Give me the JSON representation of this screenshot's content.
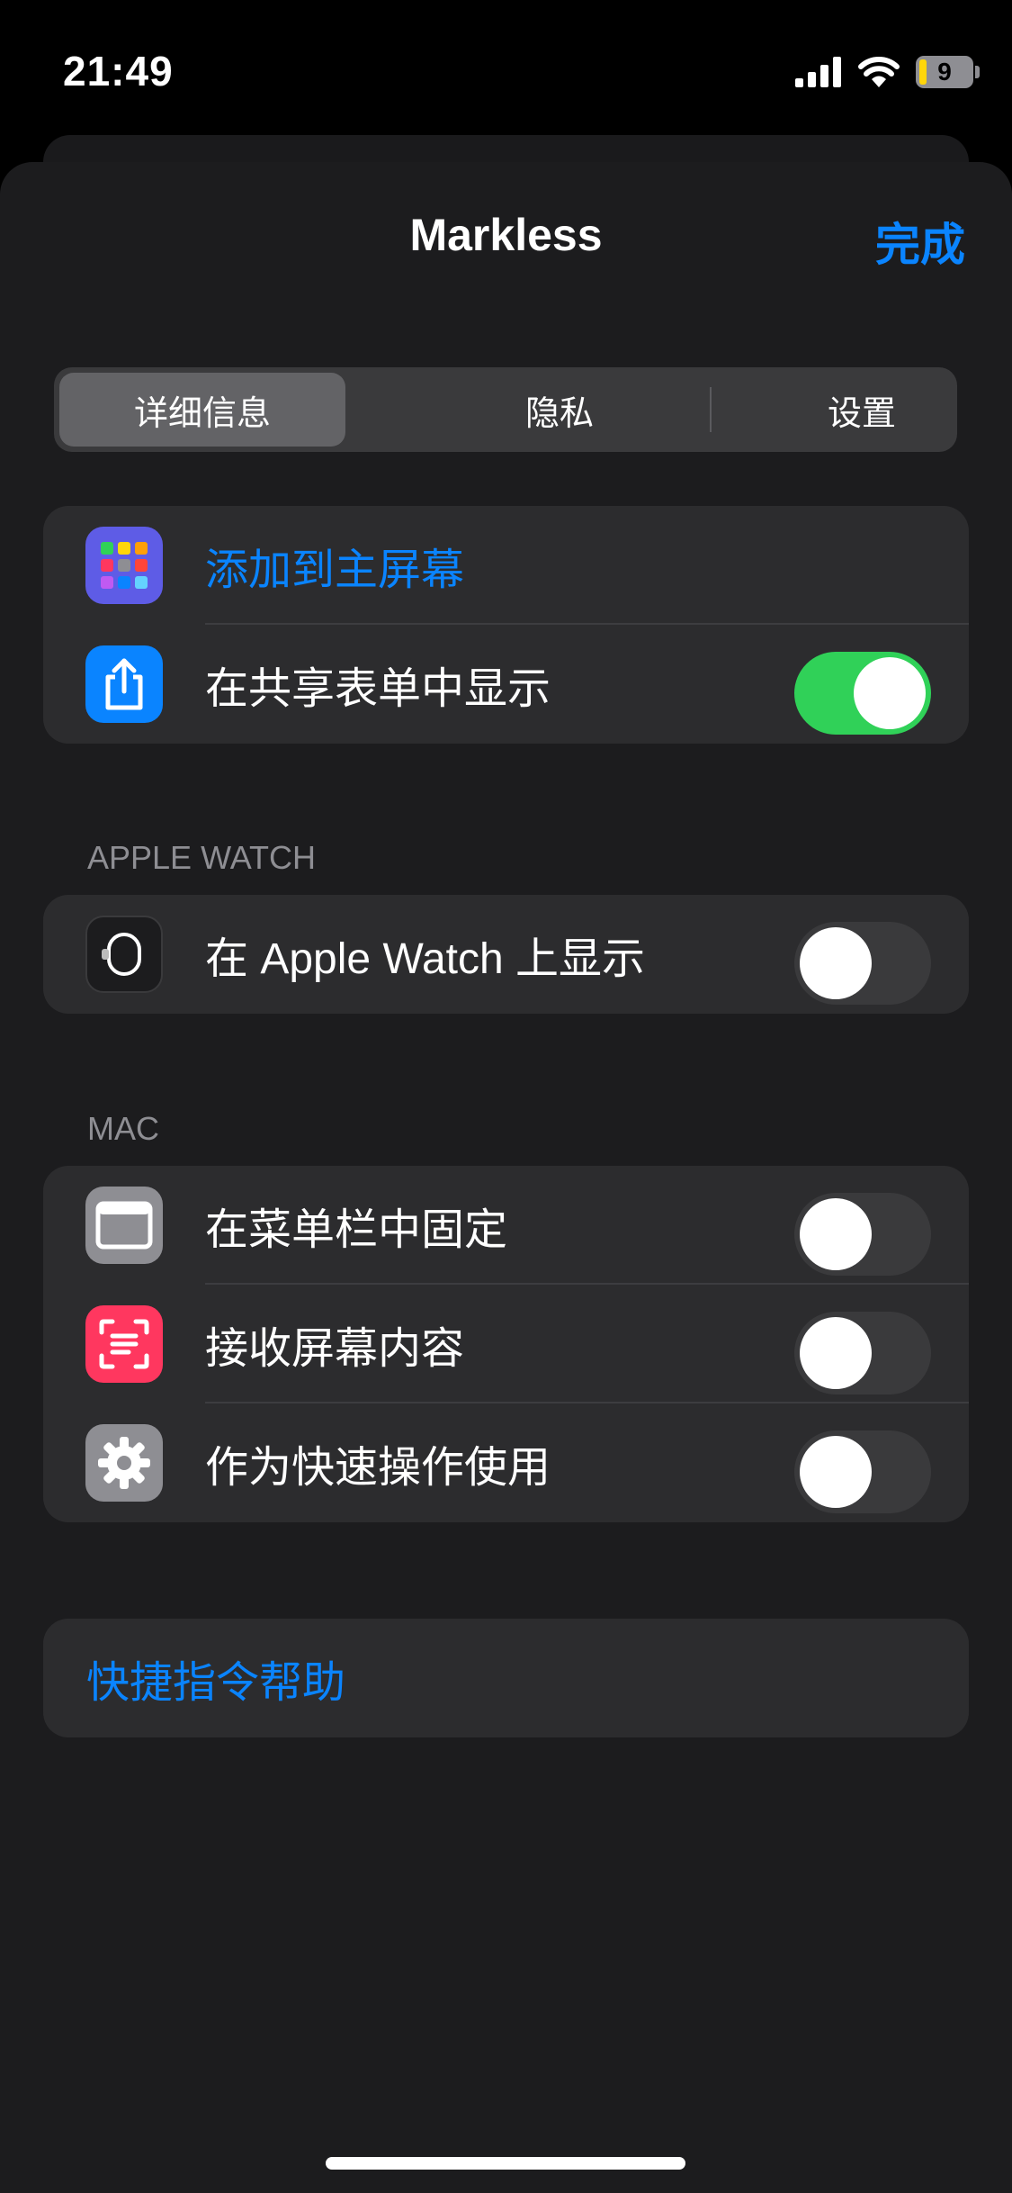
{
  "status_bar": {
    "time": "21:49",
    "battery_level": "9"
  },
  "nav": {
    "title": "Markless",
    "done_label": "完成"
  },
  "segments": [
    {
      "label": "详细信息",
      "selected": true
    },
    {
      "label": "隐私",
      "selected": false
    },
    {
      "label": "设置",
      "selected": false
    }
  ],
  "general": {
    "add_to_home": "添加到主屏幕",
    "share_sheet": {
      "label": "在共享表单中显示",
      "on": true
    }
  },
  "watch": {
    "header": "APPLE WATCH",
    "show_on_watch": {
      "label": "在 Apple Watch 上显示",
      "on": false
    }
  },
  "mac": {
    "header": "MAC",
    "pin_menu_bar": {
      "label": "在菜单栏中固定",
      "on": false
    },
    "receive_screen": {
      "label": "接收屏幕内容",
      "on": false
    },
    "quick_action": {
      "label": "作为快速操作使用",
      "on": false
    }
  },
  "help": {
    "label": "快捷指令帮助"
  },
  "colors": {
    "accent": "#0a84ff",
    "toggle_on": "#30d158",
    "background": "#1c1c1e",
    "group": "#2c2c2e"
  },
  "icons": [
    "cellular-signal-icon",
    "wifi-icon",
    "battery-icon",
    "app-grid-icon",
    "share-icon",
    "apple-watch-icon",
    "menu-bar-icon",
    "screen-capture-icon",
    "gear-icon"
  ]
}
